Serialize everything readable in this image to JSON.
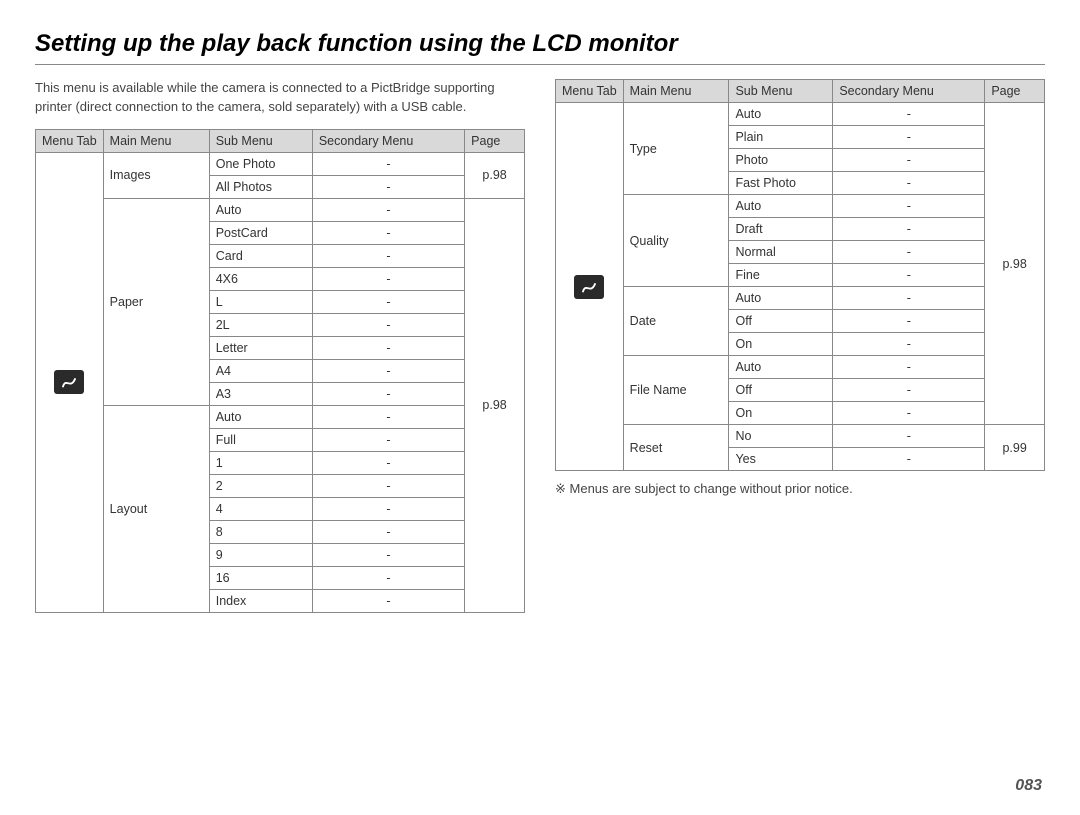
{
  "title": "Setting up the play back function using the LCD monitor",
  "intro": "This menu is available while the camera is connected to a PictBridge supporting printer (direct connection to the camera, sold separately) with a USB cable.",
  "headers": {
    "menu_tab": "Menu Tab",
    "main_menu": "Main Menu",
    "sub_menu": "Sub Menu",
    "secondary_menu": "Secondary Menu",
    "page": "Page"
  },
  "dash": "-",
  "left_table": {
    "icon_name": "pictbridge-icon",
    "page_ref": "p.98",
    "groups": [
      {
        "main": "Images",
        "subs": [
          "One Photo",
          "All Photos"
        ]
      },
      {
        "main": "Paper",
        "subs": [
          "Auto",
          "PostCard",
          "Card",
          "4X6",
          "L",
          "2L",
          "Letter",
          "A4",
          "A3"
        ]
      },
      {
        "main": "Layout",
        "subs": [
          "Auto",
          "Full",
          "1",
          "2",
          "4",
          "8",
          "9",
          "16",
          "Index"
        ]
      }
    ]
  },
  "right_table": {
    "icon_name": "pictbridge-icon",
    "page_ref_upper": "p.98",
    "page_ref_lower": "p.99",
    "upper_groups": [
      {
        "main": "Type",
        "subs": [
          "Auto",
          "Plain",
          "Photo",
          "Fast Photo"
        ]
      },
      {
        "main": "Quality",
        "subs": [
          "Auto",
          "Draft",
          "Normal",
          "Fine"
        ]
      },
      {
        "main": "Date",
        "subs": [
          "Auto",
          "Off",
          "On"
        ]
      },
      {
        "main": "File Name",
        "subs": [
          "Auto",
          "Off",
          "On"
        ]
      }
    ],
    "lower_groups": [
      {
        "main": "Reset",
        "subs": [
          "No",
          "Yes"
        ]
      }
    ]
  },
  "footnote": "※  Menus are subject to change without prior notice.",
  "page_number": "083"
}
